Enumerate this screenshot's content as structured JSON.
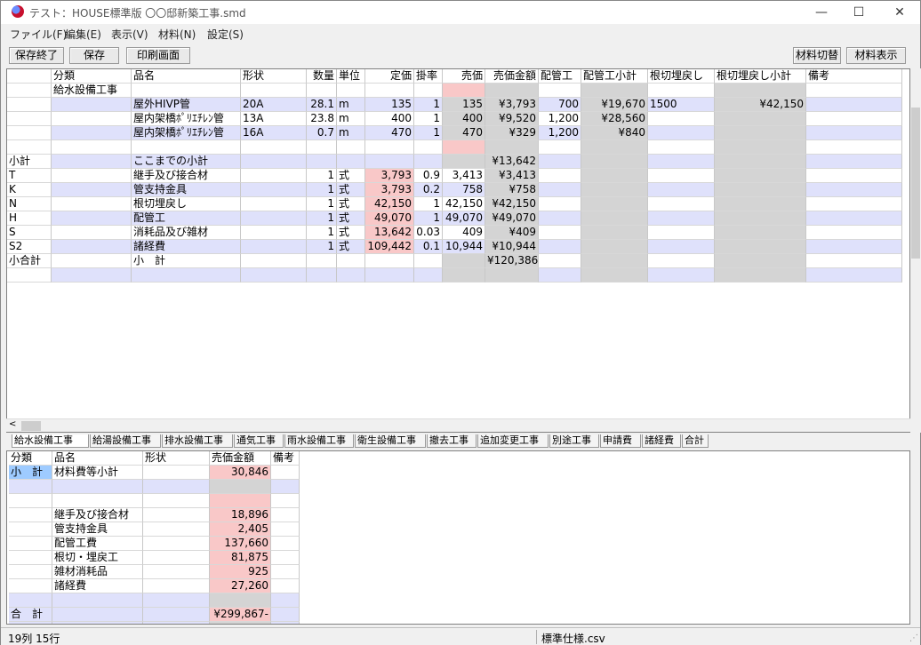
{
  "window": {
    "title": "テスト：HOUSE標準版 〇〇邸新築工事.smd",
    "controls": {
      "minimize": "—",
      "maximize": "☐",
      "close": "✕"
    }
  },
  "menu": [
    "ファイル(F)",
    "編集(E)",
    "表示(V)",
    "材料(N)",
    "設定(S)"
  ],
  "toolbar": {
    "left": [
      "保存終了",
      "保存",
      "印刷画面"
    ],
    "right": [
      "材料切替",
      "材料表示"
    ]
  },
  "top_grid": {
    "headers": [
      "分類",
      "品名",
      "形状",
      "数量",
      "単位",
      "定価",
      "掛率",
      "売価",
      "売価金額",
      "配管工",
      "配管工小計",
      "根切埋戻し",
      "根切埋戻し小計",
      "備考"
    ],
    "rows": [
      [
        "",
        "給水設備工事",
        "",
        "",
        "",
        "",
        "",
        "",
        "",
        "",
        "",
        "",
        "",
        "",
        ""
      ],
      [
        "",
        "",
        "屋外HIVP管",
        "20A",
        "28.1",
        "m",
        "135",
        "1",
        "135",
        "¥3,793",
        "700",
        "¥19,670",
        "1500",
        "¥42,150",
        ""
      ],
      [
        "",
        "",
        "屋内架橋ﾎﾟﾘｴﾁﾚﾝ管",
        "13A",
        "23.8",
        "m",
        "400",
        "1",
        "400",
        "¥9,520",
        "1,200",
        "¥28,560",
        "",
        "",
        ""
      ],
      [
        "",
        "",
        "屋内架橋ﾎﾟﾘｴﾁﾚﾝ管",
        "16A",
        "0.7",
        "m",
        "470",
        "1",
        "470",
        "¥329",
        "1,200",
        "¥840",
        "",
        "",
        ""
      ],
      [
        "",
        "",
        "",
        "",
        "",
        "",
        "",
        "",
        "",
        "",
        "",
        "",
        "",
        "",
        ""
      ],
      [
        "小計",
        "",
        "ここまでの小計",
        "",
        "",
        "",
        "",
        "",
        "",
        "¥13,642",
        "",
        "",
        "",
        "",
        ""
      ],
      [
        "T",
        "",
        "継手及び接合材",
        "",
        "1",
        "式",
        "3,793",
        "0.9",
        "3,413",
        "¥3,413",
        "",
        "",
        "",
        "",
        ""
      ],
      [
        "K",
        "",
        "管支持金具",
        "",
        "1",
        "式",
        "3,793",
        "0.2",
        "758",
        "¥758",
        "",
        "",
        "",
        "",
        ""
      ],
      [
        "N",
        "",
        "根切埋戻し",
        "",
        "1",
        "式",
        "42,150",
        "1",
        "42,150",
        "¥42,150",
        "",
        "",
        "",
        "",
        ""
      ],
      [
        "H",
        "",
        "配管工",
        "",
        "1",
        "式",
        "49,070",
        "1",
        "49,070",
        "¥49,070",
        "",
        "",
        "",
        "",
        ""
      ],
      [
        "S",
        "",
        "消耗品及び雑材",
        "",
        "1",
        "式",
        "13,642",
        "0.03",
        "409",
        "¥409",
        "",
        "",
        "",
        "",
        ""
      ],
      [
        "S2",
        "",
        "諸経費",
        "",
        "1",
        "式",
        "109,442",
        "0.1",
        "10,944",
        "¥10,944",
        "",
        "",
        "",
        "",
        ""
      ],
      [
        "小合計",
        "",
        "小　計",
        "",
        "",
        "",
        "",
        "",
        "",
        "¥120,386",
        "",
        "",
        "",
        "",
        ""
      ],
      [
        "",
        "",
        "",
        "",
        "",
        "",
        "",
        "",
        "",
        "",
        "",
        "",
        "",
        "",
        ""
      ]
    ]
  },
  "tabs": [
    "給水設備工事",
    "給湯設備工事",
    "排水設備工事",
    "通気工事",
    "雨水設備工事",
    "衛生設備工事",
    "撤去工事",
    "追加変更工事",
    "別途工事",
    "申請費",
    "諸経費",
    "合計"
  ],
  "bottom_grid": {
    "headers": [
      "分類",
      "品名",
      "形状",
      "売価金額",
      "備考"
    ],
    "rows": [
      [
        "小　計",
        "材料費等小計",
        "",
        "30,846",
        ""
      ],
      [
        "",
        "",
        "",
        "",
        ""
      ],
      [
        "",
        "",
        "",
        "",
        ""
      ],
      [
        "",
        "継手及び接合材",
        "",
        "18,896",
        ""
      ],
      [
        "",
        "管支持金具",
        "",
        "2,405",
        ""
      ],
      [
        "",
        "配管工費",
        "",
        "137,660",
        ""
      ],
      [
        "",
        "根切・埋戻工",
        "",
        "81,875",
        ""
      ],
      [
        "",
        "雑材消耗品",
        "",
        "925",
        ""
      ],
      [
        "",
        "諸経費",
        "",
        "27,260",
        ""
      ],
      [
        "",
        "",
        "",
        "",
        ""
      ],
      [
        "合　計",
        "",
        "",
        "¥299,867-",
        ""
      ],
      [
        "",
        "",
        "",
        "",
        ""
      ]
    ]
  },
  "status": {
    "left": "19列 15行",
    "right": "標準仕様.csv"
  },
  "colors": {
    "band": "#dfe1fb",
    "pink": "#f9c8c8",
    "gray": "#d4d4d4",
    "selection": "#9ecbff"
  }
}
